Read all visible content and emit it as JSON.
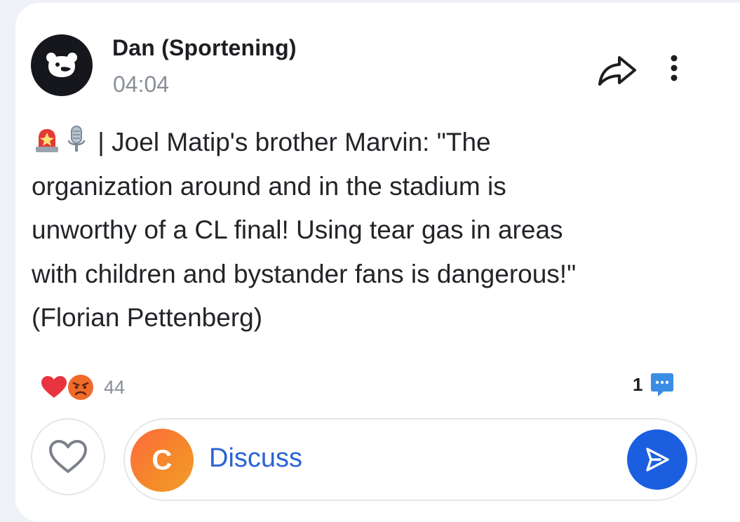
{
  "post": {
    "author": "Dan (Sportening)",
    "time": "04:04",
    "body_icons": [
      "siren-emoji",
      "microphone-emoji"
    ],
    "body_text": "| Joel Matip's brother Marvin: \"The organization around and in the stadium is unworthy of a CL final! Using tear gas in areas with children and bystander fans is dangerous!\" (Florian Pettenberg)"
  },
  "reactions": {
    "icons": [
      "heart-emoji",
      "angry-face-emoji"
    ],
    "count": "44",
    "heart_color": "#e8343f",
    "angry_color": "#f06a2a"
  },
  "comments": {
    "count": "1",
    "icon": "comment-bubble-icon",
    "color": "#3a8de3"
  },
  "composer": {
    "user_initial": "C",
    "placeholder": "Discuss",
    "send_color": "#1b5fe0"
  },
  "actions": {
    "share_icon": "share-arrow-icon",
    "more_icon": "more-vertical-icon",
    "like_icon": "heart-outline-icon"
  }
}
